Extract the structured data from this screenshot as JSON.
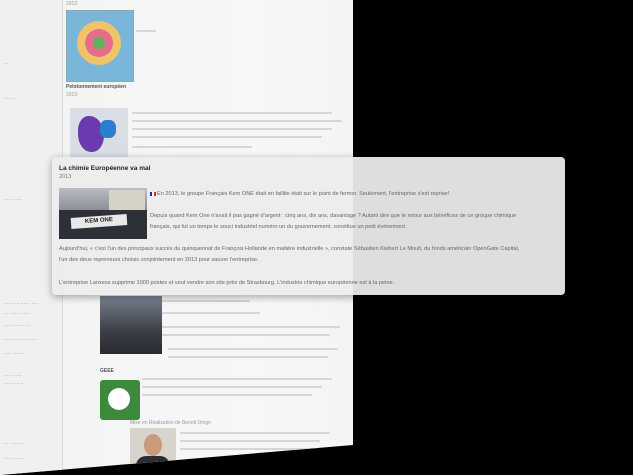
{
  "background_page": {
    "left_sidebar_lines": [
      "...",
      "........",
      "...... ......",
      "........ .......... .....",
      "... ...... ........",
      "...... ........ ...",
      "........ ..... .........",
      "..... ........",
      "...... ......",
      "........ .....",
      "... ..........",
      "...... ........"
    ],
    "section_year_top": "2013",
    "item_a_title": "Pelotonnement européen",
    "item_a_year": "2013",
    "item_b_title": "GEEE",
    "item_b_subtitle": "Mise en Réalisation de Benoît Dnigo"
  },
  "card": {
    "title": "La chimie Européenne va mal",
    "year": "2013",
    "photo_banner": "KEM ONE",
    "paragraphs": [
      "En 2013, le groupe Français Kem ONE était en faillite était sur le point de fermer. Seulement, l'entreprise s'est reprise!",
      "Depuis quand Kem One n'avait il pas gagné d'argent : cinq ans, dix ans, davantage ? Autant dire que le retour aux bénéfices de ce groupe chimique",
      "français, qui fut un temps le souci industriel numéro un du gouvernement, constitue un petit événement.",
      "Aujourd'hui, « c'est l'un des principaux succès du quinquennat de François Hollande en matière industrielle », constate Sébastien Kiebert Le Moult, du fonds américain OpenGate Capital,",
      "l'un des deux repreneurs choisis conjointement en 2013 pour sauver l'entreprise.",
      "L'entreprise Lanxess supprime 1000 postes et veut vendre son site près de Strasbourg. L'industrie chimique européenne est à la peine."
    ]
  },
  "colors": {
    "backdrop": "#000000",
    "card_bg": "#ececec",
    "text": "#666666"
  }
}
